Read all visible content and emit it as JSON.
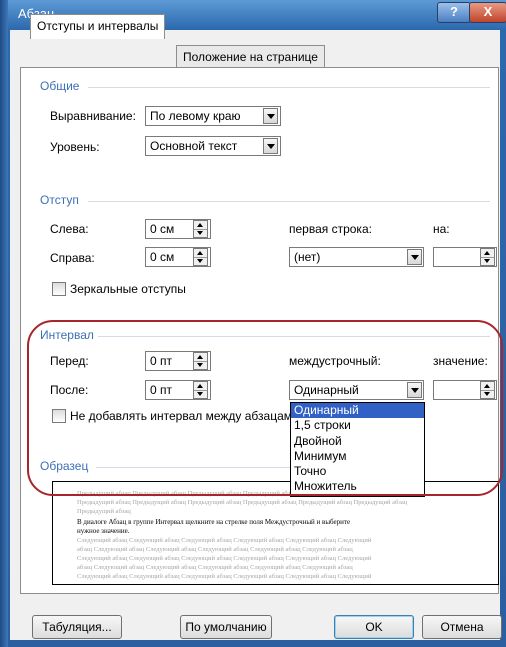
{
  "window": {
    "title": "Абзац",
    "help_label": "?",
    "close_label": "X"
  },
  "tabs": [
    {
      "label": "Отступы и интервалы",
      "active": true
    },
    {
      "label": "Положение на странице",
      "active": false
    }
  ],
  "general": {
    "title": "Общие",
    "alignment_label": "Выравнивание:",
    "alignment_value": "По левому краю",
    "level_label": "Уровень:",
    "level_value": "Основной текст"
  },
  "indent": {
    "title": "Отступ",
    "left_label": "Слева:",
    "left_value": "0 см",
    "right_label": "Справа:",
    "right_value": "0 см",
    "first_line_label": "первая строка:",
    "first_line_value": "(нет)",
    "on_label": "на:",
    "on_value": "",
    "mirror_label": "Зеркальные отступы"
  },
  "spacing": {
    "title": "Интервал",
    "before_label": "Перед:",
    "before_value": "0 пт",
    "after_label": "После:",
    "after_value": "0 пт",
    "line_label": "междустрочный:",
    "line_value": "Одинарный",
    "value_label": "значение:",
    "value_value": "",
    "no_space_label": "Не добавлять интервал между абзацами",
    "options": [
      "Одинарный",
      "1,5 строки",
      "Двойной",
      "Минимум",
      "Точно",
      "Множитель"
    ],
    "selected_index": 0
  },
  "sample": {
    "title": "Образец",
    "prev_lines": [
      "Предыдущий абзац Предыдущий абзац Предыдущий абзац Предыдущий абзац Предыдущий абзац Предыдущий абзац",
      "Предыдущий абзац Предыдущий абзац Предыдущий абзац Предыдущий абзац Предыдущий абзац Предыдущий абзац",
      "Предыдущий абзац"
    ],
    "main_lines": [
      "В диалоге Абзац в группе Интервал щелкните на стрелке поля Междустрочный и выберите",
      "нужное значение."
    ],
    "next_lines": [
      "Следующий абзац Следующий абзац Следующий абзац Следующий абзац Следующий абзац Следующий",
      "абзац Следующий абзац Следующий абзац Следующий абзац Следующий абзац Следующий абзац",
      "Следующий абзац Следующий абзац Следующий абзац Следующий абзац Следующий абзац Следующий",
      "абзац Следующий абзац Следующий абзац Следующий абзац Следующий абзац Следующий абзац",
      "Следующий абзац Следующий абзац Следующий абзац Следующий абзац Следующий абзац Следующий"
    ]
  },
  "buttons": {
    "tabs": "Табуляция...",
    "default": "По умолчанию",
    "ok": "OK",
    "cancel": "Отмена"
  },
  "colors": {
    "group_title": "#3c6fb5",
    "selection": "#3161c4",
    "highlight_oval": "#a8262b"
  }
}
